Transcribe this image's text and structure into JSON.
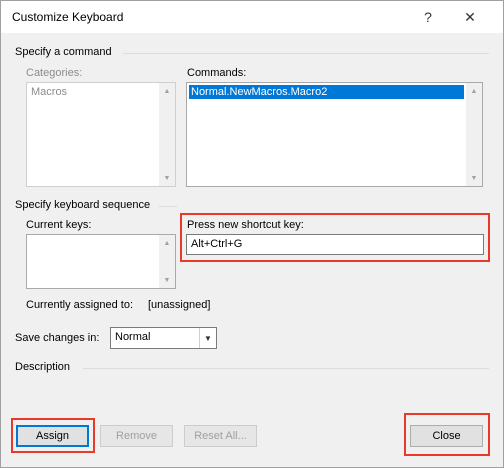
{
  "window": {
    "title": "Customize Keyboard",
    "help_glyph": "?",
    "close_glyph": "✕"
  },
  "command_section": {
    "heading": "Specify a command",
    "categories_label": "Categories:",
    "categories_items": [
      "Macros"
    ],
    "commands_label": "Commands:",
    "commands_items": [
      "Normal.NewMacros.Macro2"
    ]
  },
  "keyboard_section": {
    "heading": "Specify keyboard sequence",
    "current_keys_label": "Current keys:",
    "new_shortcut_label": "Press new shortcut key:",
    "new_shortcut_value": "Alt+Ctrl+G",
    "assigned_label": "Currently assigned to:",
    "assigned_value": "[unassigned]"
  },
  "save": {
    "label": "Save changes in:",
    "value": "Normal"
  },
  "description": {
    "heading": "Description"
  },
  "buttons": {
    "assign": "Assign",
    "remove": "Remove",
    "reset_all": "Reset All...",
    "close": "Close"
  },
  "colors": {
    "selection": "#0078d7",
    "highlight_box": "#e8392b"
  }
}
